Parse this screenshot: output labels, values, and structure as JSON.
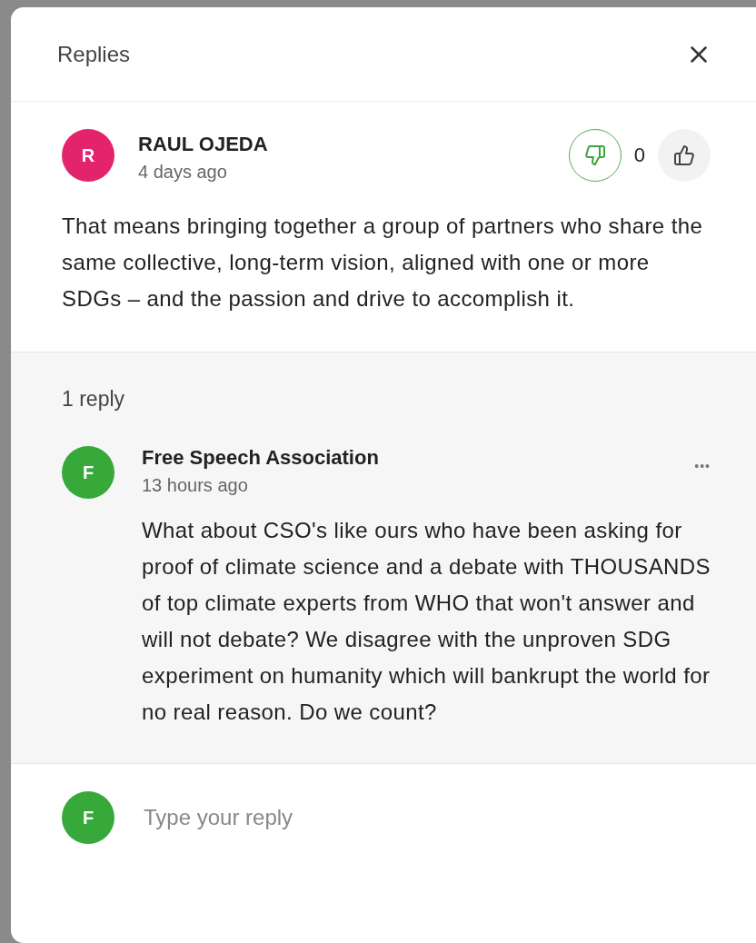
{
  "panel": {
    "title": "Replies"
  },
  "comment": {
    "initial": "R",
    "color": "#e3236b",
    "author": "RAUL OJEDA",
    "time": "4 days ago",
    "votes": [
      {
        "kind": "dislike",
        "selected": true
      },
      {
        "kind": "like",
        "selected": false
      }
    ],
    "score": "0",
    "text": "That means bringing together a group of partners who share the same collective, long-term vision, aligned with one or more SDGs – and the passion and drive to accomplish it."
  },
  "replies": {
    "count": "1 reply",
    "items": [
      {
        "initial": "F",
        "color": "#36a93a",
        "author": "Free Speech Association",
        "time": "13 hours ago",
        "menu": "•••",
        "text": "What about CSO's like ours who have been asking for proof of climate science and a debate with THOUSANDS of top climate experts from WHO that won't answer and will not debate? We disagree with the unproven SDG experiment on humanity which will bankrupt the world for no real reason. Do we count?"
      }
    ]
  },
  "composer": {
    "initial": "F",
    "color": "#36a93a",
    "placeholder": "Type your reply"
  }
}
